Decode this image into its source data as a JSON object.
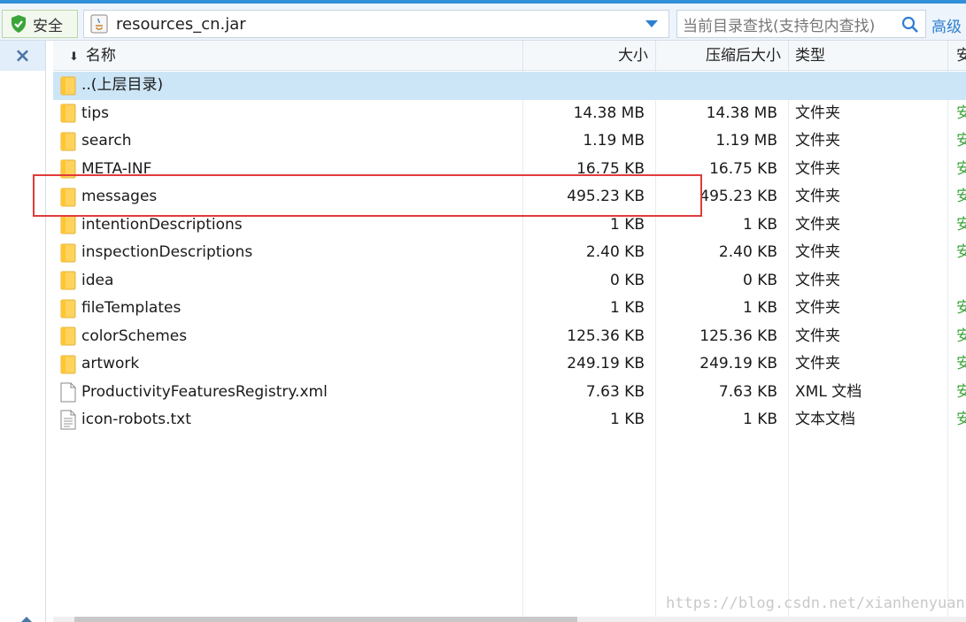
{
  "toolbar": {
    "safe_label": "安全",
    "path": "resources_cn.jar",
    "search_placeholder": "当前目录查找(支持包内查找)",
    "advanced_label": "高级"
  },
  "left_pane": {
    "close_glyph": "×"
  },
  "columns": {
    "name": "名称",
    "size": "大小",
    "compressed_size": "压缩后大小",
    "type": "类型",
    "safe": "安"
  },
  "rows": [
    {
      "name": "..(上层目录)",
      "size": "",
      "compressed_size": "",
      "type": "",
      "safe": "",
      "icon": "folder-icon",
      "selected": true
    },
    {
      "name": "tips",
      "size": "14.38 MB",
      "compressed_size": "14.38 MB",
      "type": "文件夹",
      "safe": "安",
      "icon": "folder-icon"
    },
    {
      "name": "search",
      "size": "1.19 MB",
      "compressed_size": "1.19 MB",
      "type": "文件夹",
      "safe": "安",
      "icon": "folder-icon"
    },
    {
      "name": "META-INF",
      "size": "16.75 KB",
      "compressed_size": "16.75 KB",
      "type": "文件夹",
      "safe": "安",
      "icon": "folder-icon"
    },
    {
      "name": "messages",
      "size": "495.23 KB",
      "compressed_size": "495.23 KB",
      "type": "文件夹",
      "safe": "安",
      "icon": "folder-icon"
    },
    {
      "name": "intentionDescriptions",
      "size": "1 KB",
      "compressed_size": "1 KB",
      "type": "文件夹",
      "safe": "安",
      "icon": "folder-icon"
    },
    {
      "name": "inspectionDescriptions",
      "size": "2.40 KB",
      "compressed_size": "2.40 KB",
      "type": "文件夹",
      "safe": "安",
      "icon": "folder-icon"
    },
    {
      "name": "idea",
      "size": "0 KB",
      "compressed_size": "0 KB",
      "type": "文件夹",
      "safe": "",
      "icon": "folder-icon"
    },
    {
      "name": "fileTemplates",
      "size": "1 KB",
      "compressed_size": "1 KB",
      "type": "文件夹",
      "safe": "安",
      "icon": "folder-icon"
    },
    {
      "name": "colorSchemes",
      "size": "125.36 KB",
      "compressed_size": "125.36 KB",
      "type": "文件夹",
      "safe": "安",
      "icon": "folder-icon"
    },
    {
      "name": "artwork",
      "size": "249.19 KB",
      "compressed_size": "249.19 KB",
      "type": "文件夹",
      "safe": "安",
      "icon": "folder-icon"
    },
    {
      "name": "ProductivityFeaturesRegistry.xml",
      "size": "7.63 KB",
      "compressed_size": "7.63 KB",
      "type": "XML 文档",
      "safe": "安",
      "icon": "file-icon"
    },
    {
      "name": "icon-robots.txt",
      "size": "1 KB",
      "compressed_size": "1 KB",
      "type": "文本文档",
      "safe": "安",
      "icon": "text-file-icon"
    }
  ],
  "watermark": "https://blog.csdn.net/xianhenyuan",
  "colors": {
    "accent": "#2f8fd8",
    "selected_row": "#cde6f7",
    "highlight_box": "#e03b3b",
    "safe_green": "#3aa53a"
  }
}
